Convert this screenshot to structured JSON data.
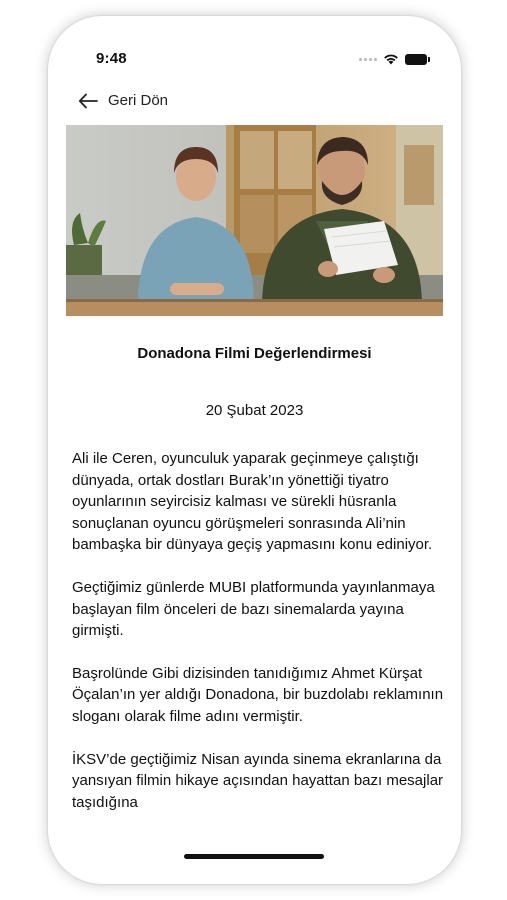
{
  "status_bar": {
    "time": "9:48"
  },
  "nav": {
    "back_label": "Geri Dön"
  },
  "article": {
    "title": "Donadona Filmi Değerlendirmesi",
    "date": "20 Şubat 2023",
    "paragraphs": [
      "Ali ile Ceren, oyunculuk yaparak geçinmeye çalıştığı dünyada, ortak dostları Burak’ın yönettiği tiyatro oyunlarının seyircisiz kalması ve sürekli hüsranla sonuçlanan oyuncu görüşmeleri sonrasında Ali’nin bambaşka bir dünyaya geçiş yapmasını konu ediniyor.",
      "Geçtiğimiz günlerde MUBI platformunda yayınlanmaya başlayan film önceleri de bazı sinemalarda yayına girmişti.",
      "Başrolünde Gibi dizisinden tanıdığımız Ahmet Kürşat Öçalan’ın yer aldığı Donadona, bir buzdolabı reklamının sloganı olarak filme adını vermiştir.",
      "İKSV’de geçtiğimiz Nisan ayında sinema ekranlarına da yansıyan filmin hikaye açısından hayattan bazı mesajlar taşıdığına"
    ]
  },
  "icons": {
    "back": "arrow-left-icon",
    "wifi": "wifi-icon",
    "battery": "battery-icon",
    "signal": "signal-dots-icon"
  }
}
